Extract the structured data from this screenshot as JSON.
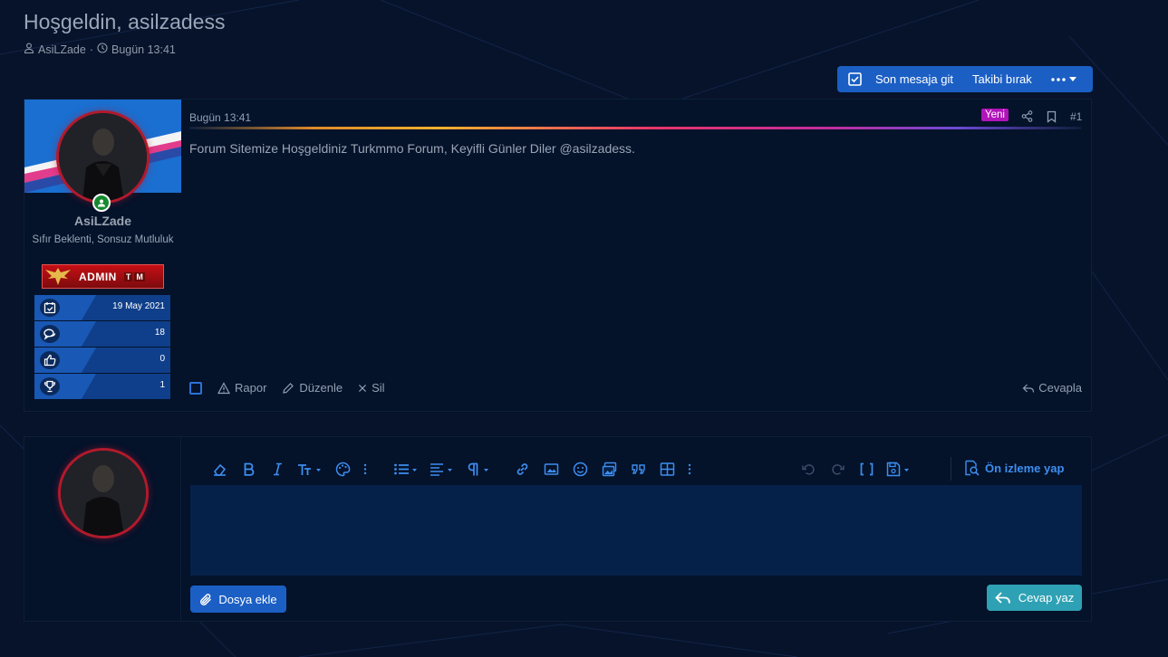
{
  "thread": {
    "title": "Hoşgeldin, asilzadess",
    "author": "AsiLZade",
    "separator": "·",
    "date": "Bugün 13:41"
  },
  "topbar": {
    "last_message_label": "Son mesaja git",
    "unfollow_label": "Takibi bırak"
  },
  "post": {
    "date": "Bugün 13:41",
    "new_badge": "Yeni",
    "number": "#1",
    "body": "Forum Sitemize Hoşgeldiniz Turkmmo Forum, Keyifli Günler Diler @asilzadess.",
    "user": {
      "name": "AsiLZade",
      "title": "Sıfır Beklenti, Sonsuz Mutluluk",
      "badge_label": "ADMIN",
      "badge_tm": [
        "T",
        "M"
      ],
      "stats": [
        {
          "icon": "calendar-check-icon",
          "value": "19 May 2021"
        },
        {
          "icon": "comments-icon",
          "value": "18"
        },
        {
          "icon": "thumbs-up-icon",
          "value": "0"
        },
        {
          "icon": "trophy-icon",
          "value": "1"
        }
      ]
    },
    "actions": {
      "report": "Rapor",
      "edit": "Düzenle",
      "delete": "Sil",
      "reply": "Cevapla"
    }
  },
  "editor": {
    "preview_label": "Ön izleme yap",
    "attach_label": "Dosya ekle",
    "submit_label": "Cevap yaz"
  },
  "colors": {
    "background": "#07132a",
    "panel": "#04122a",
    "accent": "#1b5fc4",
    "submit": "#2fa1b4",
    "new_badge": "#b114b9"
  }
}
